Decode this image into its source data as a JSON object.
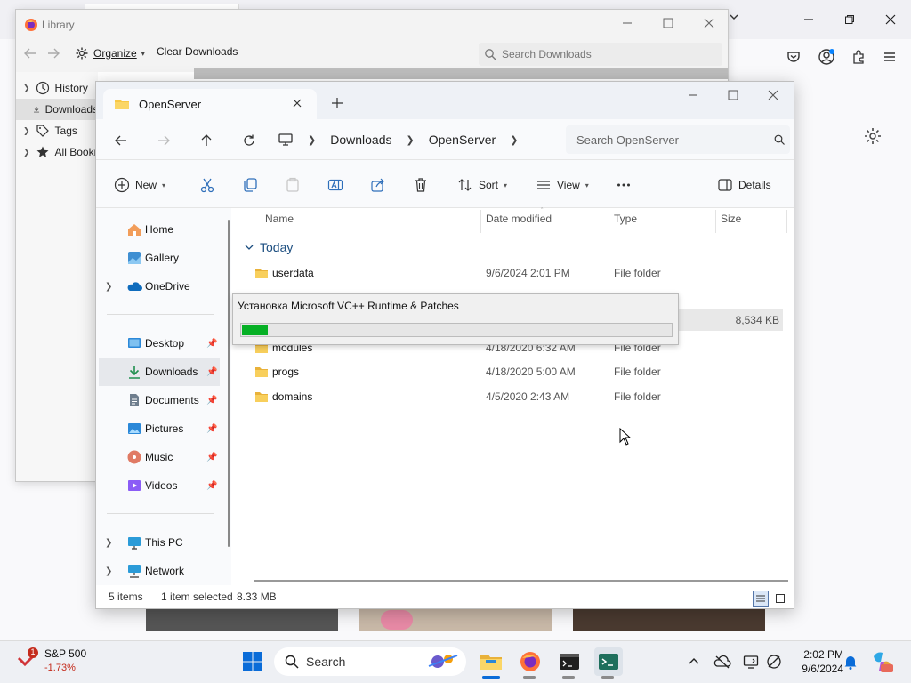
{
  "library": {
    "title": "Library",
    "organize_label": "Organize",
    "clear_downloads_label": "Clear Downloads",
    "search_placeholder": "Search Downloads",
    "tree": [
      "History",
      "Downloads",
      "Tags",
      "All Bookmarks"
    ]
  },
  "explorer": {
    "tab_title": "OpenServer",
    "breadcrumb": [
      "Downloads",
      "OpenServer"
    ],
    "search_placeholder": "Search OpenServer",
    "commands": {
      "new": "New",
      "sort": "Sort",
      "view": "View",
      "details": "Details"
    },
    "nav": {
      "home": "Home",
      "gallery": "Gallery",
      "onedrive": "OneDrive",
      "desktop": "Desktop",
      "downloads": "Downloads",
      "documents": "Documents",
      "pictures": "Pictures",
      "music": "Music",
      "videos": "Videos",
      "thispc": "This PC",
      "network": "Network"
    },
    "columns": {
      "name": "Name",
      "date": "Date modified",
      "type": "Type",
      "size": "Size"
    },
    "group_label": "Today",
    "rows": [
      {
        "name": "userdata",
        "date": "9/6/2024 2:01 PM",
        "type": "File folder",
        "size": ""
      },
      {
        "name": "",
        "date": "",
        "type": "",
        "size": "8,534 KB"
      },
      {
        "name": "modules",
        "date": "4/18/2020 6:32 AM",
        "type": "File folder",
        "size": ""
      },
      {
        "name": "progs",
        "date": "4/18/2020 5:00 AM",
        "type": "File folder",
        "size": ""
      },
      {
        "name": "domains",
        "date": "4/5/2020 2:43 AM",
        "type": "File folder",
        "size": ""
      }
    ],
    "status": {
      "items": "5 items",
      "selected": "1 item selected",
      "size": "8.33 MB"
    }
  },
  "installer": {
    "title": "Установка Microsoft VC++ Runtime & Patches",
    "progress_percent": 6,
    "progress_color": "#06b025"
  },
  "taskbar": {
    "stock_name": "S&P 500",
    "stock_change": "-1.73%",
    "stock_badge": "1",
    "search_label": "Search",
    "time": "2:02 PM",
    "date": "9/6/2024"
  }
}
